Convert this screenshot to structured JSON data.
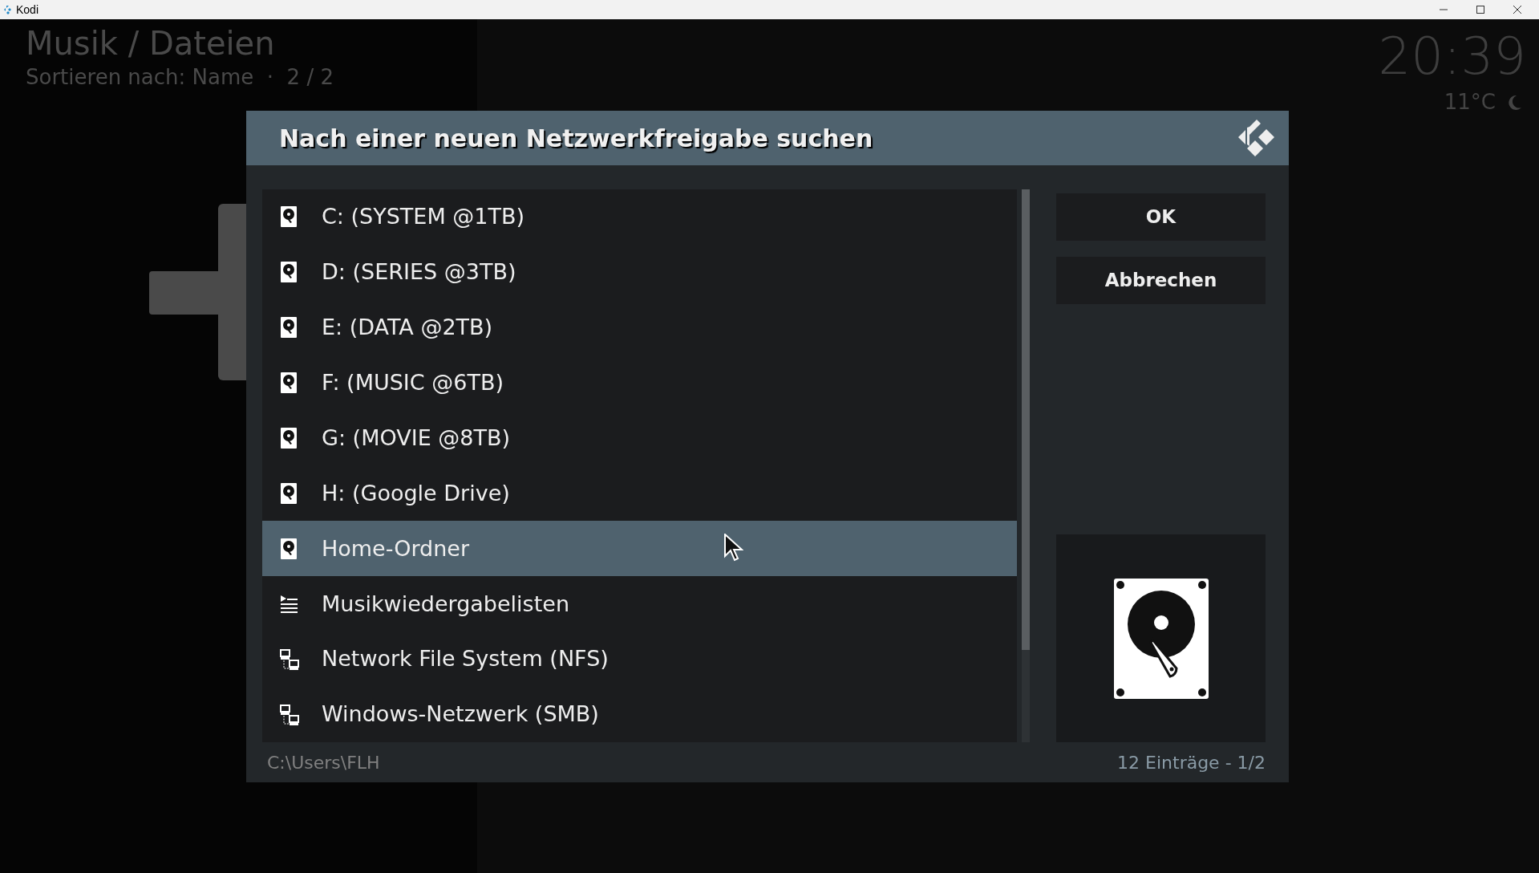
{
  "window": {
    "title": "Kodi"
  },
  "header": {
    "title": "Musik / Dateien",
    "subtitle": "Sortieren nach: Name  ·  2 / 2",
    "clock": "20:39",
    "temperature": "11°C"
  },
  "dialog": {
    "title": "Nach einer neuen Netzwerkfreigabe suchen",
    "items": [
      {
        "label": "C: (SYSTEM @1TB)",
        "kind": "drive",
        "selected": false
      },
      {
        "label": "D: (SERIES @3TB)",
        "kind": "drive",
        "selected": false
      },
      {
        "label": "E: (DATA @2TB)",
        "kind": "drive",
        "selected": false
      },
      {
        "label": "F: (MUSIC @6TB)",
        "kind": "drive",
        "selected": false
      },
      {
        "label": "G: (MOVIE @8TB)",
        "kind": "drive",
        "selected": false
      },
      {
        "label": "H: (Google Drive)",
        "kind": "drive",
        "selected": false
      },
      {
        "label": "Home-Ordner",
        "kind": "drive",
        "selected": true
      },
      {
        "label": "Musikwiedergabelisten",
        "kind": "playlist",
        "selected": false
      },
      {
        "label": "Network File System (NFS)",
        "kind": "network",
        "selected": false
      },
      {
        "label": "Windows-Netzwerk (SMB)",
        "kind": "network",
        "selected": false
      }
    ],
    "buttons": [
      "OK",
      "Abbrechen"
    ],
    "path": "C:\\Users\\FLH",
    "count": "12 Einträge - 1/2"
  }
}
